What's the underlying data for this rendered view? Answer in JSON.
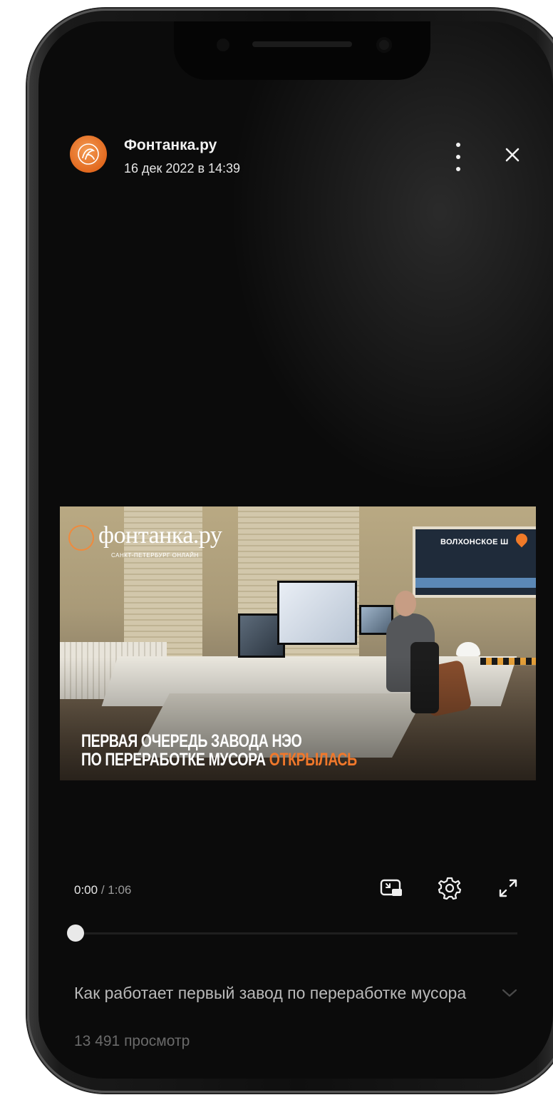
{
  "app": {
    "accent_color": "#f0782b"
  },
  "header": {
    "channel_name": "Фонтанка.ру",
    "post_date": "16 дек 2022 в 14:39",
    "more_icon": "more-vertical-icon",
    "close_icon": "close-icon"
  },
  "video": {
    "logo_text": "фонтанка.ру",
    "logo_subtitle": "САНКТ-ПЕТЕРБУРГ ОНЛАЙН",
    "location": "ВОЛХОНСКОЕ Ш",
    "headline_line1": "ПЕРВАЯ ОЧЕРЕДЬ ЗАВОДА НЭО",
    "headline_line2_prefix": "ПО ПЕРЕРАБОТКЕ МУСОРА ",
    "headline_line2_accent": "ОТКРЫЛАСЬ"
  },
  "player": {
    "current_time": "0:00",
    "separator": " / ",
    "duration": "1:06",
    "progress_fraction": 0,
    "icons": [
      "picture-in-picture-icon",
      "settings-gear-icon",
      "fullscreen-expand-icon"
    ]
  },
  "info": {
    "title": "Как работает первый завод по переработке мусора",
    "views": "13 491 просмотр",
    "expand_icon": "chevron-down-icon"
  }
}
